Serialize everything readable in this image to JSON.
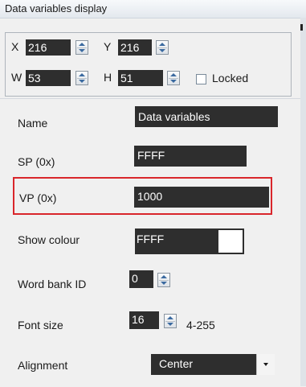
{
  "panel": {
    "title": "Data variables display",
    "geometry": {
      "x_label": "X",
      "x_value": "216",
      "y_label": "Y",
      "y_value": "216",
      "w_label": "W",
      "w_value": "53",
      "h_label": "H",
      "h_value": "51",
      "locked_label": "Locked",
      "locked_checked": false
    }
  },
  "properties": {
    "name_label": "Name",
    "name_value": "Data variables",
    "sp_label": "SP (0x)",
    "sp_value": "FFFF",
    "vp_label": "VP (0x)",
    "vp_value": "1000",
    "show_colour_label": "Show colour",
    "show_colour_value": "FFFF",
    "word_bank_label": "Word bank ID",
    "word_bank_value": "0",
    "font_size_label": "Font size",
    "font_size_value": "16",
    "font_size_range": "4-255",
    "alignment_label": "Alignment",
    "alignment_value": "Center"
  },
  "colors": {
    "field_bg": "#2e2e2e",
    "highlight_border": "#d9262b"
  }
}
